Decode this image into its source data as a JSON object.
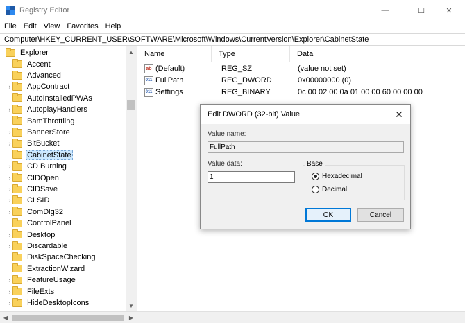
{
  "window": {
    "title": "Registry Editor",
    "min_glyph": "—",
    "max_glyph": "☐",
    "close_glyph": "✕"
  },
  "menu": [
    "File",
    "Edit",
    "View",
    "Favorites",
    "Help"
  ],
  "address": "Computer\\HKEY_CURRENT_USER\\SOFTWARE\\Microsoft\\Windows\\CurrentVersion\\Explorer\\CabinetState",
  "tree": {
    "root": "Explorer",
    "items": [
      {
        "label": "Accent",
        "expandable": false
      },
      {
        "label": "Advanced",
        "expandable": false
      },
      {
        "label": "AppContract",
        "expandable": true
      },
      {
        "label": "AutoInstalledPWAs",
        "expandable": false
      },
      {
        "label": "AutoplayHandlers",
        "expandable": true
      },
      {
        "label": "BamThrottling",
        "expandable": false
      },
      {
        "label": "BannerStore",
        "expandable": true
      },
      {
        "label": "BitBucket",
        "expandable": true
      },
      {
        "label": "CabinetState",
        "expandable": false,
        "selected": true
      },
      {
        "label": "CD Burning",
        "expandable": true
      },
      {
        "label": "CIDOpen",
        "expandable": true
      },
      {
        "label": "CIDSave",
        "expandable": true
      },
      {
        "label": "CLSID",
        "expandable": true
      },
      {
        "label": "ComDlg32",
        "expandable": true
      },
      {
        "label": "ControlPanel",
        "expandable": false
      },
      {
        "label": "Desktop",
        "expandable": true
      },
      {
        "label": "Discardable",
        "expandable": true
      },
      {
        "label": "DiskSpaceChecking",
        "expandable": false
      },
      {
        "label": "ExtractionWizard",
        "expandable": false
      },
      {
        "label": "FeatureUsage",
        "expandable": true
      },
      {
        "label": "FileExts",
        "expandable": true
      },
      {
        "label": "HideDesktopIcons",
        "expandable": true
      }
    ]
  },
  "list": {
    "columns": [
      "Name",
      "Type",
      "Data"
    ],
    "rows": [
      {
        "icon": "string-value-icon",
        "badge": "ab",
        "name": "(Default)",
        "type": "REG_SZ",
        "data": "(value not set)"
      },
      {
        "icon": "binary-value-icon",
        "badge": "011",
        "name": "FullPath",
        "type": "REG_DWORD",
        "data": "0x00000000 (0)"
      },
      {
        "icon": "binary-value-icon",
        "badge": "011",
        "name": "Settings",
        "type": "REG_BINARY",
        "data": "0c 00 02 00 0a 01 00 00 60 00 00 00"
      }
    ]
  },
  "dialog": {
    "title": "Edit DWORD (32-bit) Value",
    "close_glyph": "✕",
    "value_name_label": "Value name:",
    "value_name": "FullPath",
    "value_data_label": "Value data:",
    "value_data": "1",
    "base_label": "Base",
    "radio_hex": "Hexadecimal",
    "radio_dec": "Decimal",
    "selected_base": "Hexadecimal",
    "ok_label": "OK",
    "cancel_label": "Cancel"
  }
}
